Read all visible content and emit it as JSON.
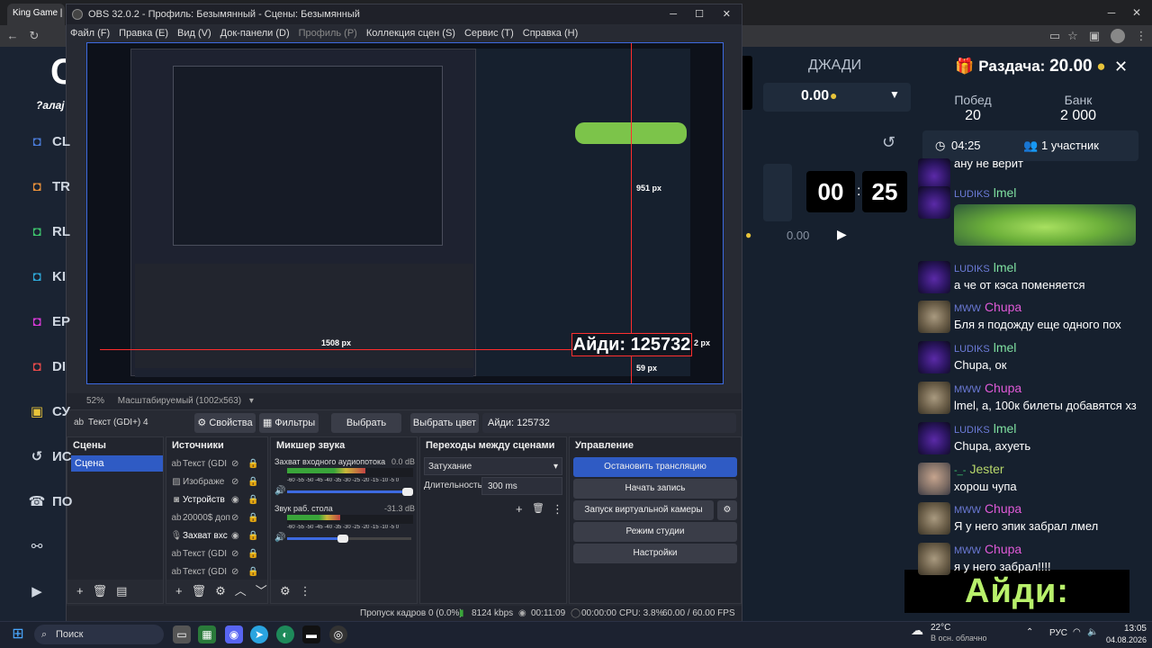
{
  "browser": {
    "tab_title": "King Game |",
    "controls": {
      "minimize": "─",
      "maximize": "☐",
      "close": "✕"
    }
  },
  "site": {
    "logo_partial": "C",
    "tagline_partial": "?алај",
    "sidebar": {
      "items": [
        {
          "label": "CL",
          "icon": "gamepad-icon",
          "color": "#4a7bd8"
        },
        {
          "label": "TR",
          "icon": "gamepad-icon",
          "color": "#e8903a"
        },
        {
          "label": "RL",
          "icon": "gamepad-icon",
          "color": "#3ec46d"
        },
        {
          "label": "KI",
          "icon": "gamepad-icon",
          "color": "#2ea8d8"
        },
        {
          "label": "EP",
          "icon": "gamepad-icon",
          "color": "#d83ad8"
        },
        {
          "label": "DI",
          "icon": "gamepad-icon",
          "color": "#e84a4a"
        },
        {
          "label": "СУ",
          "icon": "box-icon",
          "color": "#e8c43a"
        },
        {
          "label": "ИС",
          "icon": "history-icon",
          "color": "#cfd6e0"
        },
        {
          "label": "ПО",
          "icon": "support-icon",
          "color": "#cfd6e0"
        },
        {
          "label": "",
          "icon": "handshake-icon",
          "color": "#cfd6e0"
        },
        {
          "label": "",
          "icon": "youtube-icon",
          "color": "#cfd6e0"
        }
      ]
    },
    "game": {
      "mode": "ДЖАДИ",
      "bet_value": "0.00",
      "timer_minutes": "00",
      "timer_seconds": "25",
      "pot": "0.00"
    },
    "right_panel": {
      "header_label": "Раздача:",
      "header_amount": "20.00",
      "wins_label": "Побед",
      "wins_value": "20",
      "bank_label": "Банк",
      "bank_value": "2 000",
      "time": "04:25",
      "participants": "1 участник"
    },
    "chat": [
      {
        "tag": "",
        "name": "",
        "name_color": "#ffffff",
        "text": "ану не верит",
        "avatar": "purple"
      },
      {
        "tag": "LUDIKS",
        "name": "lmel",
        "name_color": "#7fe0a0",
        "text": "",
        "avatar": "purple",
        "has_image": true
      },
      {
        "tag": "LUDIKS",
        "name": "lmel",
        "name_color": "#7fe0a0",
        "text": "а че от кэса поменяется",
        "avatar": "purple"
      },
      {
        "tag": "MWW",
        "name": "Chupa",
        "name_color": "#e05ad8",
        "text": "Бля я подожду еще одного пох",
        "avatar": "brown"
      },
      {
        "tag": "LUDIKS",
        "name": "lmel",
        "name_color": "#7fe0a0",
        "text": "Chupa, ок",
        "avatar": "purple"
      },
      {
        "tag": "MWW",
        "name": "Chupa",
        "name_color": "#e05ad8",
        "text": "lmel, а, 100к билеты добавятся хз",
        "avatar": "brown"
      },
      {
        "tag": "LUDIKS",
        "name": "lmel",
        "name_color": "#7fe0a0",
        "text": "Chupa, ахуеть",
        "avatar": "purple"
      },
      {
        "tag": "-_-",
        "name": "Jester",
        "name_color": "#b8d86b",
        "text": "хорош чупа",
        "avatar": "face"
      },
      {
        "tag": "MWW",
        "name": "Chupa",
        "name_color": "#e05ad8",
        "text": "Я у него эпик забрал лмел",
        "avatar": "brown"
      },
      {
        "tag": "MWW",
        "name": "Chupa",
        "name_color": "#e05ad8",
        "text": "я у него забрал!!!!",
        "avatar": "brown"
      }
    ],
    "overlay_id": "Айди: 125732"
  },
  "obs": {
    "title": "OBS 32.0.2 - Профиль: Безымянный - Сцены: Безымянный",
    "menu": [
      "Файл (F)",
      "Правка (E)",
      "Вид (V)",
      "Док-панели (D)",
      "Профиль (P)",
      "Коллекция сцен (S)",
      "Сервис (T)",
      "Справка (H)"
    ],
    "preview": {
      "aidi_label": "Айди: 125732",
      "px_top": "951 px",
      "px_bottom": "59 px",
      "px_left": "1508 px",
      "px_right": "2 px"
    },
    "zoom": "52%",
    "scale_mode": "Масштабируемый (1002x563)",
    "source_bar": {
      "source_name": "Текст (GDI+) 4",
      "properties": "Свойства",
      "filters": "Фильтры",
      "select_font": "Выбрать шрифт",
      "select_color": "Выбрать цвет",
      "text_value": "Айди: 125732"
    },
    "docks": {
      "scenes": {
        "title": "Сцены",
        "items": [
          "Сцена"
        ]
      },
      "sources": {
        "title": "Источники",
        "items": [
          {
            "label": "Текст (GDI",
            "icon": "text-icon"
          },
          {
            "label": "Изображе",
            "icon": "image-icon"
          },
          {
            "label": "Устройств",
            "icon": "camera-icon"
          },
          {
            "label": "20000$ доп",
            "icon": "text-icon"
          },
          {
            "label": "Захват вхс",
            "icon": "mic-icon"
          },
          {
            "label": "Текст (GDI",
            "icon": "text-icon"
          },
          {
            "label": "Текст (GDI",
            "icon": "text-icon"
          }
        ]
      },
      "mixer": {
        "title": "Микшер звука",
        "channels": [
          {
            "name": "Захват входного аудиопотока",
            "db": "0.0 dB",
            "level": 0.62,
            "volume": 0.97
          },
          {
            "name": "Звук раб. стола",
            "db": "-31.3 dB",
            "level": 0.42,
            "volume": 0.45
          }
        ],
        "scale": "-60 -55 -50 -45 -40 -35 -30 -25 -20 -15 -10 -5 0"
      },
      "transitions": {
        "title": "Переходы между сценами",
        "type": "Затухание",
        "duration_label": "Длительность",
        "duration_value": "300 ms"
      },
      "controls": {
        "title": "Управление",
        "buttons": [
          "Остановить трансляцию",
          "Начать запись",
          "Запуск виртуальной камеры",
          "Режим студии",
          "Настройки"
        ]
      }
    },
    "status": {
      "dropped": "Пропуск кадров 0 (0.0%)",
      "bitrate": "8124 kbps",
      "stream_time": "00:11:09",
      "rec_time": "00:00:00",
      "cpu": "CPU: 3.8%",
      "fps": "60.00 / 60.00 FPS"
    }
  },
  "taskbar": {
    "search": "Поиск",
    "weather_temp": "22°C",
    "weather_desc": "В осн. облачно",
    "lang": "РУС",
    "time": "13:05",
    "date": "04.08.2026"
  }
}
